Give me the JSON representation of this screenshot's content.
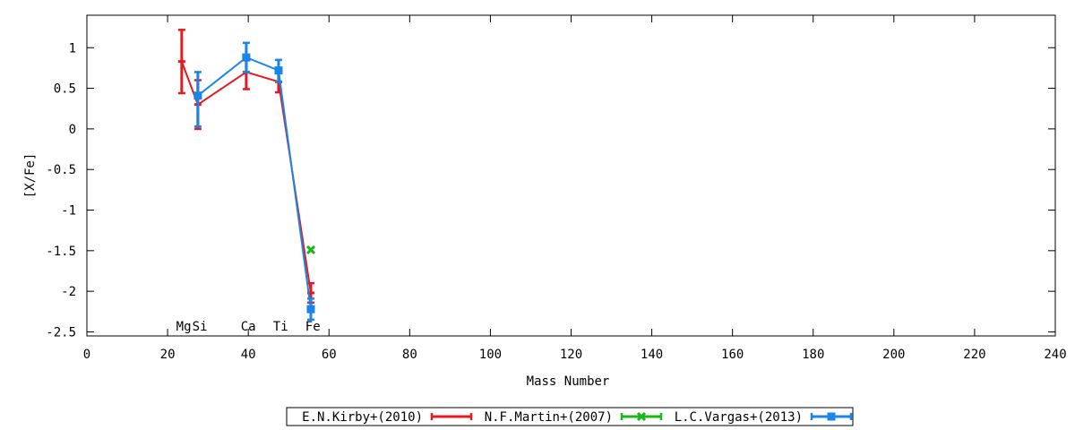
{
  "chart_data": {
    "type": "line",
    "xlabel": "Mass Number",
    "ylabel": "[X/Fe]",
    "xlim": [
      0,
      240
    ],
    "ylim": [
      -2.55,
      1.4
    ],
    "xticks": [
      0,
      20,
      40,
      60,
      80,
      100,
      120,
      140,
      160,
      180,
      200,
      220,
      240
    ],
    "yticks": [
      -2.5,
      -2,
      -1.5,
      -1,
      -0.5,
      0,
      0.5,
      1
    ],
    "grid": false,
    "legend_position": "bottom",
    "element_labels": [
      {
        "text": "Mg",
        "x": 24
      },
      {
        "text": "Si",
        "x": 28
      },
      {
        "text": "Ca",
        "x": 40
      },
      {
        "text": "Ti",
        "x": 48
      },
      {
        "text": "Fe",
        "x": 56
      }
    ],
    "series": [
      {
        "name": "E.N.Kirby+(2010)",
        "color": "#e8191c",
        "marker": "bar",
        "points": [
          {
            "x": 23.5,
            "y": 0.83,
            "ylo": 0.44,
            "yhi": 1.22
          },
          {
            "x": 27.5,
            "y": 0.3,
            "ylo": 0.0,
            "yhi": 0.6
          },
          {
            "x": 39.5,
            "y": 0.7,
            "ylo": 0.49,
            "yhi": 0.91
          },
          {
            "x": 47.5,
            "y": 0.58,
            "ylo": 0.45,
            "yhi": 0.71
          },
          {
            "x": 55.5,
            "y": -2.02,
            "ylo": -2.14,
            "yhi": -1.9
          }
        ]
      },
      {
        "name": "N.F.Martin+(2007)",
        "color": "#17b817",
        "marker": "cross",
        "points": [
          {
            "x": 55.5,
            "y": -1.49,
            "ylo": -1.49,
            "yhi": -1.49
          }
        ]
      },
      {
        "name": "L.C.Vargas+(2013)",
        "color": "#1a84e8",
        "marker": "square",
        "points": [
          {
            "x": 27.5,
            "y": 0.41,
            "ylo": 0.03,
            "yhi": 0.7
          },
          {
            "x": 39.5,
            "y": 0.88,
            "ylo": 0.7,
            "yhi": 1.06
          },
          {
            "x": 47.5,
            "y": 0.72,
            "ylo": 0.58,
            "yhi": 0.85
          },
          {
            "x": 55.5,
            "y": -2.22,
            "ylo": -2.35,
            "yhi": -2.09
          }
        ]
      }
    ]
  }
}
